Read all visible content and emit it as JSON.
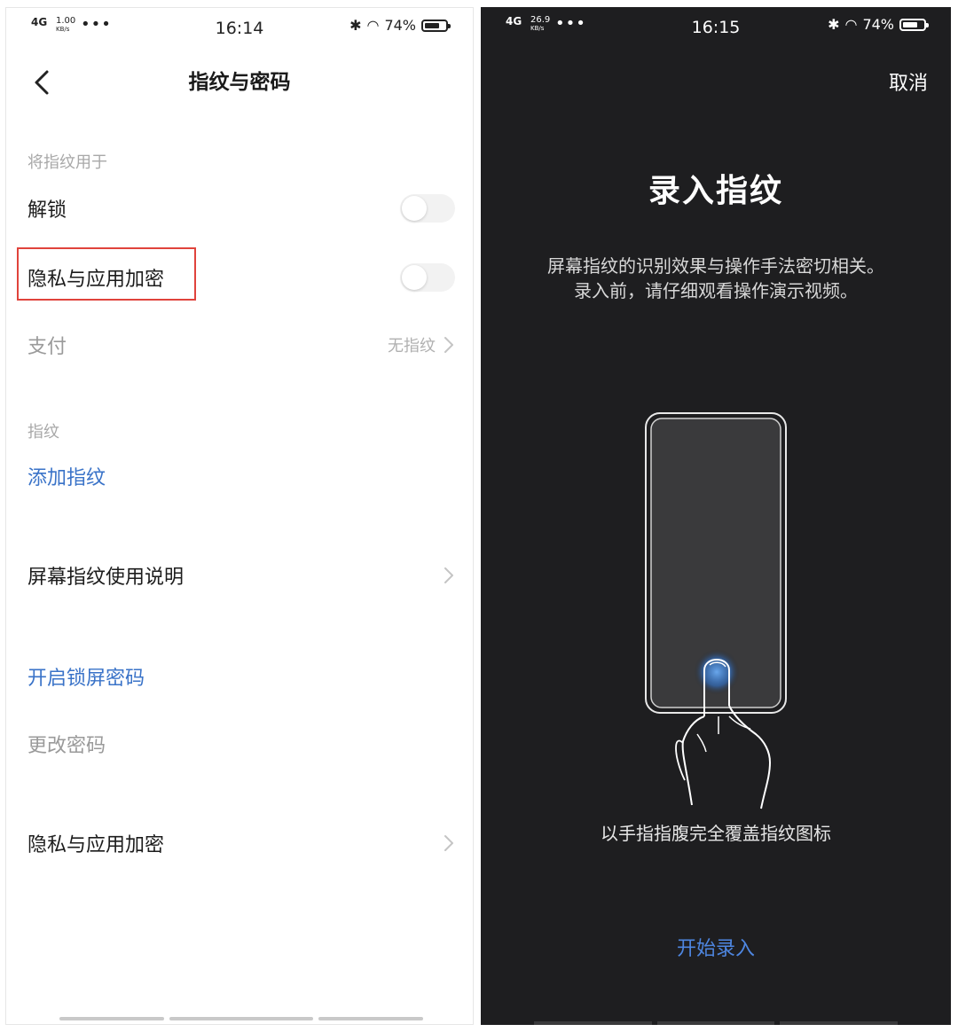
{
  "left": {
    "status": {
      "net": "4G",
      "speed": "1.00",
      "speed_unit": "KB/s",
      "more": "•••",
      "time": "16:14",
      "bluetooth": "✱",
      "wifi": "◠",
      "battery": "74%",
      "battery_level": 0.74
    },
    "header": {
      "title": "指纹与密码"
    },
    "section_use": "将指纹用于",
    "unlock_label": "解锁",
    "unlock_on": false,
    "privacy_label": "隐私与应用加密",
    "privacy_on": false,
    "payment_label": "支付",
    "payment_value": "无指纹",
    "section_fp": "指纹",
    "add_fp_label": "添加指纹",
    "instructions_label": "屏幕指纹使用说明",
    "enable_lock_label": "开启锁屏密码",
    "change_pwd_label": "更改密码",
    "privacy_bottom_label": "隐私与应用加密",
    "colors": {
      "accent_blue": "#3a73c8",
      "highlight_red": "#e0433c"
    }
  },
  "right": {
    "status": {
      "net": "4G",
      "speed": "26.9",
      "speed_unit": "KB/s",
      "more": "•••",
      "time": "16:15",
      "bluetooth": "✱",
      "wifi": "◠",
      "battery": "74%",
      "battery_level": 0.74
    },
    "cancel_label": "取消",
    "title": "录入指纹",
    "desc_line1": "屏幕指纹的识别效果与操作手法密切相关。",
    "desc_line2": "录入前，请仔细观看操作演示视频。",
    "hint": "以手指指腹完全覆盖指纹图标",
    "start_label": "开始录入",
    "colors": {
      "background": "#1e1e20",
      "start_blue": "#4e86e0"
    }
  }
}
